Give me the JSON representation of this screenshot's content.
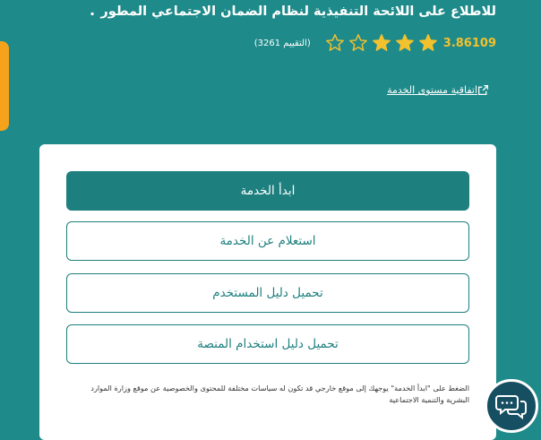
{
  "header": {
    "title": "للاطلاع على اللائحة التنفيذية لنظام الضمان الاجتماعي المطور",
    "trailing_dot": "."
  },
  "rating": {
    "value": "3.86109",
    "stars_filled": 3,
    "stars_total": 5,
    "count_label": "(التقييم 3261)",
    "star_color": "#f2c12e"
  },
  "sla_link": {
    "label": "اتفاقية مستوى الخدمة",
    "icon": "external-link-icon"
  },
  "actions": {
    "start_service": "ابدأ الخدمة",
    "inquiry": "استعلام عن الخدمة",
    "user_guide": "تحميل دليل المستخدم",
    "platform_guide": "تحميل دليل استخدام المنصة"
  },
  "disclaimer": "الضغط على \"ابدأ الخدمة\" يوجهك إلى موقع خارجي قد تكون له سياسات مختلفة للمحتوى والخصوصية عن موقع وزارة الموارد البشرية والتنمية الاجتماعية",
  "colors": {
    "background": "#1f8a8a",
    "primary": "#1e7f7f",
    "accent_tab": "#f7a21b",
    "chat_fab": "#164e62"
  },
  "chat": {
    "icon": "chat-bubbles-icon"
  }
}
